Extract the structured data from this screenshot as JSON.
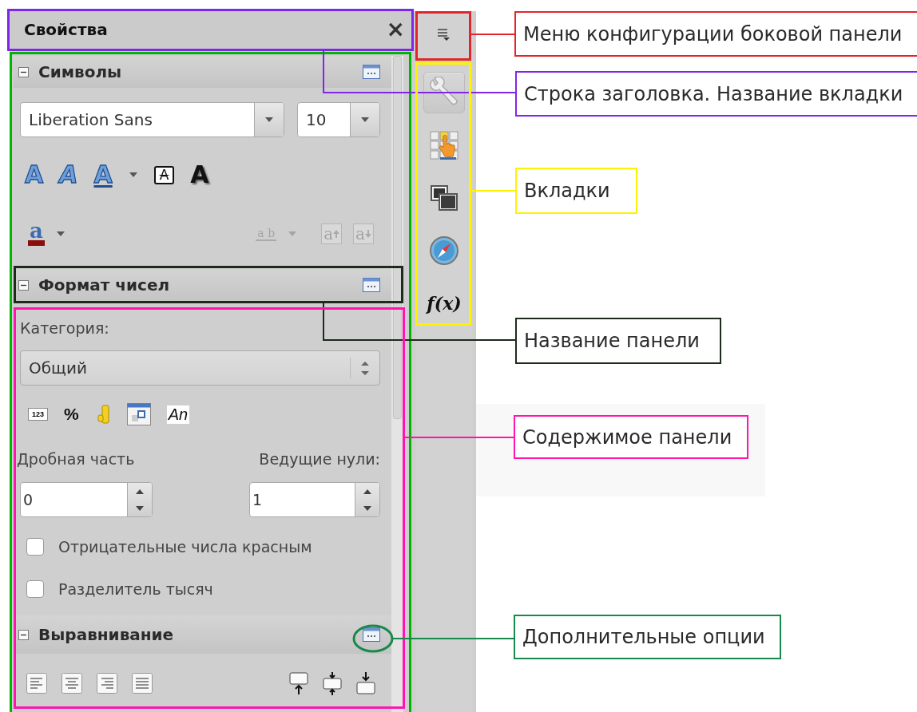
{
  "title_bar": {
    "title": "Свойства",
    "close": "×"
  },
  "tabs": [
    {
      "kind": "properties",
      "selected": true
    },
    {
      "kind": "styles",
      "selected": false
    },
    {
      "kind": "gallery",
      "selected": false
    },
    {
      "kind": "navigator",
      "selected": false
    },
    {
      "kind": "functions",
      "label": "f(x)",
      "selected": false
    }
  ],
  "panels": [
    {
      "kind": "character",
      "title": "Символы",
      "expanded": true,
      "font": "Liberation Sans",
      "size": "10",
      "effects": [
        {
          "kind": "bold",
          "label": "A"
        },
        {
          "kind": "italic",
          "label": "A"
        },
        {
          "kind": "underline",
          "label": "A"
        },
        {
          "kind": "dropdown"
        },
        {
          "kind": "strikethrough",
          "label": "A"
        },
        {
          "kind": "shadow",
          "label": "A"
        }
      ],
      "tools": [
        {
          "kind": "highlight",
          "label": "a",
          "disabled": false
        },
        {
          "kind": "dropdown",
          "disabled": false
        },
        {
          "kind": "spacing",
          "label": "a b",
          "disabled": true
        },
        {
          "kind": "dropdown",
          "disabled": true
        },
        {
          "kind": "grow",
          "label": "a",
          "disabled": true
        },
        {
          "kind": "shrink",
          "label": "a",
          "disabled": true
        }
      ]
    },
    {
      "kind": "number",
      "title": "Формат чисел",
      "expanded": true,
      "category_label": "Категория:",
      "category": "Общий",
      "formats": [
        {
          "kind": "number",
          "label": "123"
        },
        {
          "kind": "percent",
          "label": "%"
        },
        {
          "kind": "currency"
        },
        {
          "kind": "date"
        },
        {
          "kind": "text",
          "label": "An"
        }
      ],
      "decimals_label": "Дробная часть",
      "decimals": "0",
      "leading_label": "Ведущие нули:",
      "leading": "1",
      "checkboxes": [
        {
          "label": "Отрицательные числа красным",
          "checked": false
        },
        {
          "label": "Разделитель тысяч",
          "checked": false
        }
      ]
    },
    {
      "kind": "alignment",
      "title": "Выравнивание",
      "expanded": true,
      "buttons": [
        {
          "kind": "left"
        },
        {
          "kind": "center"
        },
        {
          "kind": "right"
        },
        {
          "kind": "justify"
        },
        {
          "kind": "top"
        },
        {
          "kind": "middle"
        },
        {
          "kind": "bottom"
        }
      ]
    }
  ],
  "callouts": [
    {
      "label": "Меню конфигурации боковой панели",
      "color": "#e3242b"
    },
    {
      "label": "Строка заголовка. Название вкладки",
      "color": "#8126e6"
    },
    {
      "label": "Вкладки",
      "color": "#fff200"
    },
    {
      "label": "Название панели",
      "color": "#1e2a1e"
    },
    {
      "label": "Содержимое панели",
      "color": "#ff14b0"
    },
    {
      "label": "Дополнительные опции",
      "color": "#17894a"
    }
  ]
}
